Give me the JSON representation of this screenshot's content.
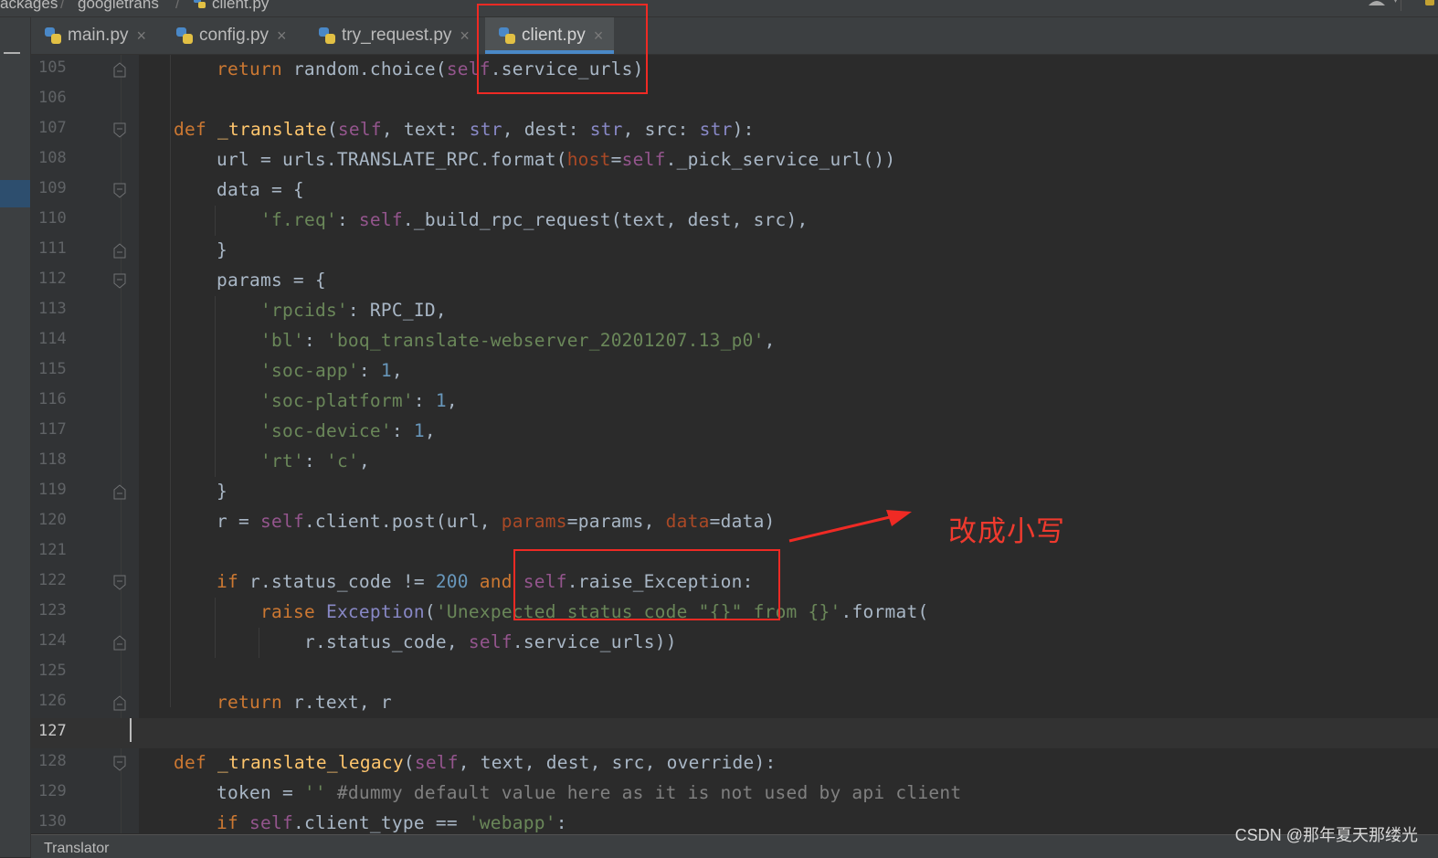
{
  "breadcrumb": {
    "part1": "ackages",
    "part2": "googletrans",
    "part3": "client.py",
    "sep": "/"
  },
  "tabs": [
    {
      "label": "main.py",
      "close": "×"
    },
    {
      "label": "config.py",
      "close": "×"
    },
    {
      "label": "try_request.py",
      "close": "×"
    },
    {
      "label": "client.py",
      "close": "×",
      "active": true
    }
  ],
  "editor": {
    "current_line": "127",
    "lines": {
      "l105": {
        "n": "105",
        "kw": "return",
        "rest1": " random.choice(",
        "self": "self",
        "rest2": ".service_urls)"
      },
      "l106": {
        "n": "106"
      },
      "l107": {
        "n": "107",
        "kw": "def",
        "sp": " ",
        "fn": "_translate",
        "p1": "(",
        "self": "self",
        "p2": ", text: ",
        "t1": "str",
        "p3": ", dest: ",
        "t2": "str",
        "p4": ", src: ",
        "t3": "str",
        "p5": "):"
      },
      "l108": {
        "n": "108",
        "a": "url = urls.TRANSLATE_RPC.format(",
        "kwarg": "host",
        "b": "=",
        "self": "self",
        "c": "._pick_service_url())"
      },
      "l109": {
        "n": "109",
        "a": "data = {"
      },
      "l110": {
        "n": "110",
        "str": "'f.req'",
        "a": ": ",
        "self": "self",
        "b": "._build_rpc_request(text, dest, src),"
      },
      "l111": {
        "n": "111",
        "a": "}"
      },
      "l112": {
        "n": "112",
        "a": "params = {"
      },
      "l113": {
        "n": "113",
        "str": "'rpcids'",
        "a": ": RPC_ID,"
      },
      "l114": {
        "n": "114",
        "str": "'bl'",
        "a": ": ",
        "str2": "'boq_translate-webserver_20201207.13_p0'",
        "b": ","
      },
      "l115": {
        "n": "115",
        "str": "'soc-app'",
        "a": ": ",
        "num": "1",
        "b": ","
      },
      "l116": {
        "n": "116",
        "str": "'soc-platform'",
        "a": ": ",
        "num": "1",
        "b": ","
      },
      "l117": {
        "n": "117",
        "str": "'soc-device'",
        "a": ": ",
        "num": "1",
        "b": ","
      },
      "l118": {
        "n": "118",
        "str": "'rt'",
        "a": ": ",
        "str2": "'c'",
        "b": ","
      },
      "l119": {
        "n": "119",
        "a": "}"
      },
      "l120": {
        "n": "120",
        "a": "r = ",
        "self": "self",
        "b": ".client.post(url, ",
        "kw1": "params",
        "c": "=params, ",
        "kw2": "data",
        "d": "=data)"
      },
      "l121": {
        "n": "121"
      },
      "l122": {
        "n": "122",
        "kw": "if",
        "a": " r.status_code != ",
        "num": "200",
        "sp": " ",
        "kw2": "and",
        "sp2": " ",
        "self": "self",
        "b": ".raise_Exception:"
      },
      "l123": {
        "n": "123",
        "kw": "raise",
        "sp": " ",
        "bi": "Exception",
        "a": "(",
        "str": "'Unexpected status code \"{}\" from {}'",
        "b": ".format("
      },
      "l124": {
        "n": "124",
        "a": "r.status_code, ",
        "self": "self",
        "b": ".service_urls))"
      },
      "l125": {
        "n": "125"
      },
      "l126": {
        "n": "126",
        "kw": "return",
        "a": " r.text, r"
      },
      "l127": {
        "n": "127"
      },
      "l128": {
        "n": "128",
        "kw": "def",
        "sp": " ",
        "fn": "_translate_legacy",
        "p1": "(",
        "self": "self",
        "p2": ", text, dest, src, override):"
      },
      "l129": {
        "n": "129",
        "a": "token = ",
        "str": "''",
        "sp": " ",
        "cmt": "#dummy default value here as it is not used by api client"
      },
      "l130": {
        "n": "130",
        "kw": "if",
        "sp": " ",
        "self": "self",
        "a": ".client_type == ",
        "str": "'webapp'",
        "b": ":"
      }
    }
  },
  "bottom_panel": {
    "label": "Translator"
  },
  "annotation": {
    "text": "改成小写",
    "color": "#ef2a24"
  },
  "watermark": "CSDN @那年夏天那缕光",
  "colors": {
    "keyword": "#cc7832",
    "function": "#ffc66d",
    "self": "#94558d",
    "string": "#6a8759",
    "number": "#6897bb",
    "kwarg": "#aa4926",
    "builtin": "#8888c6",
    "comment": "#808080"
  }
}
